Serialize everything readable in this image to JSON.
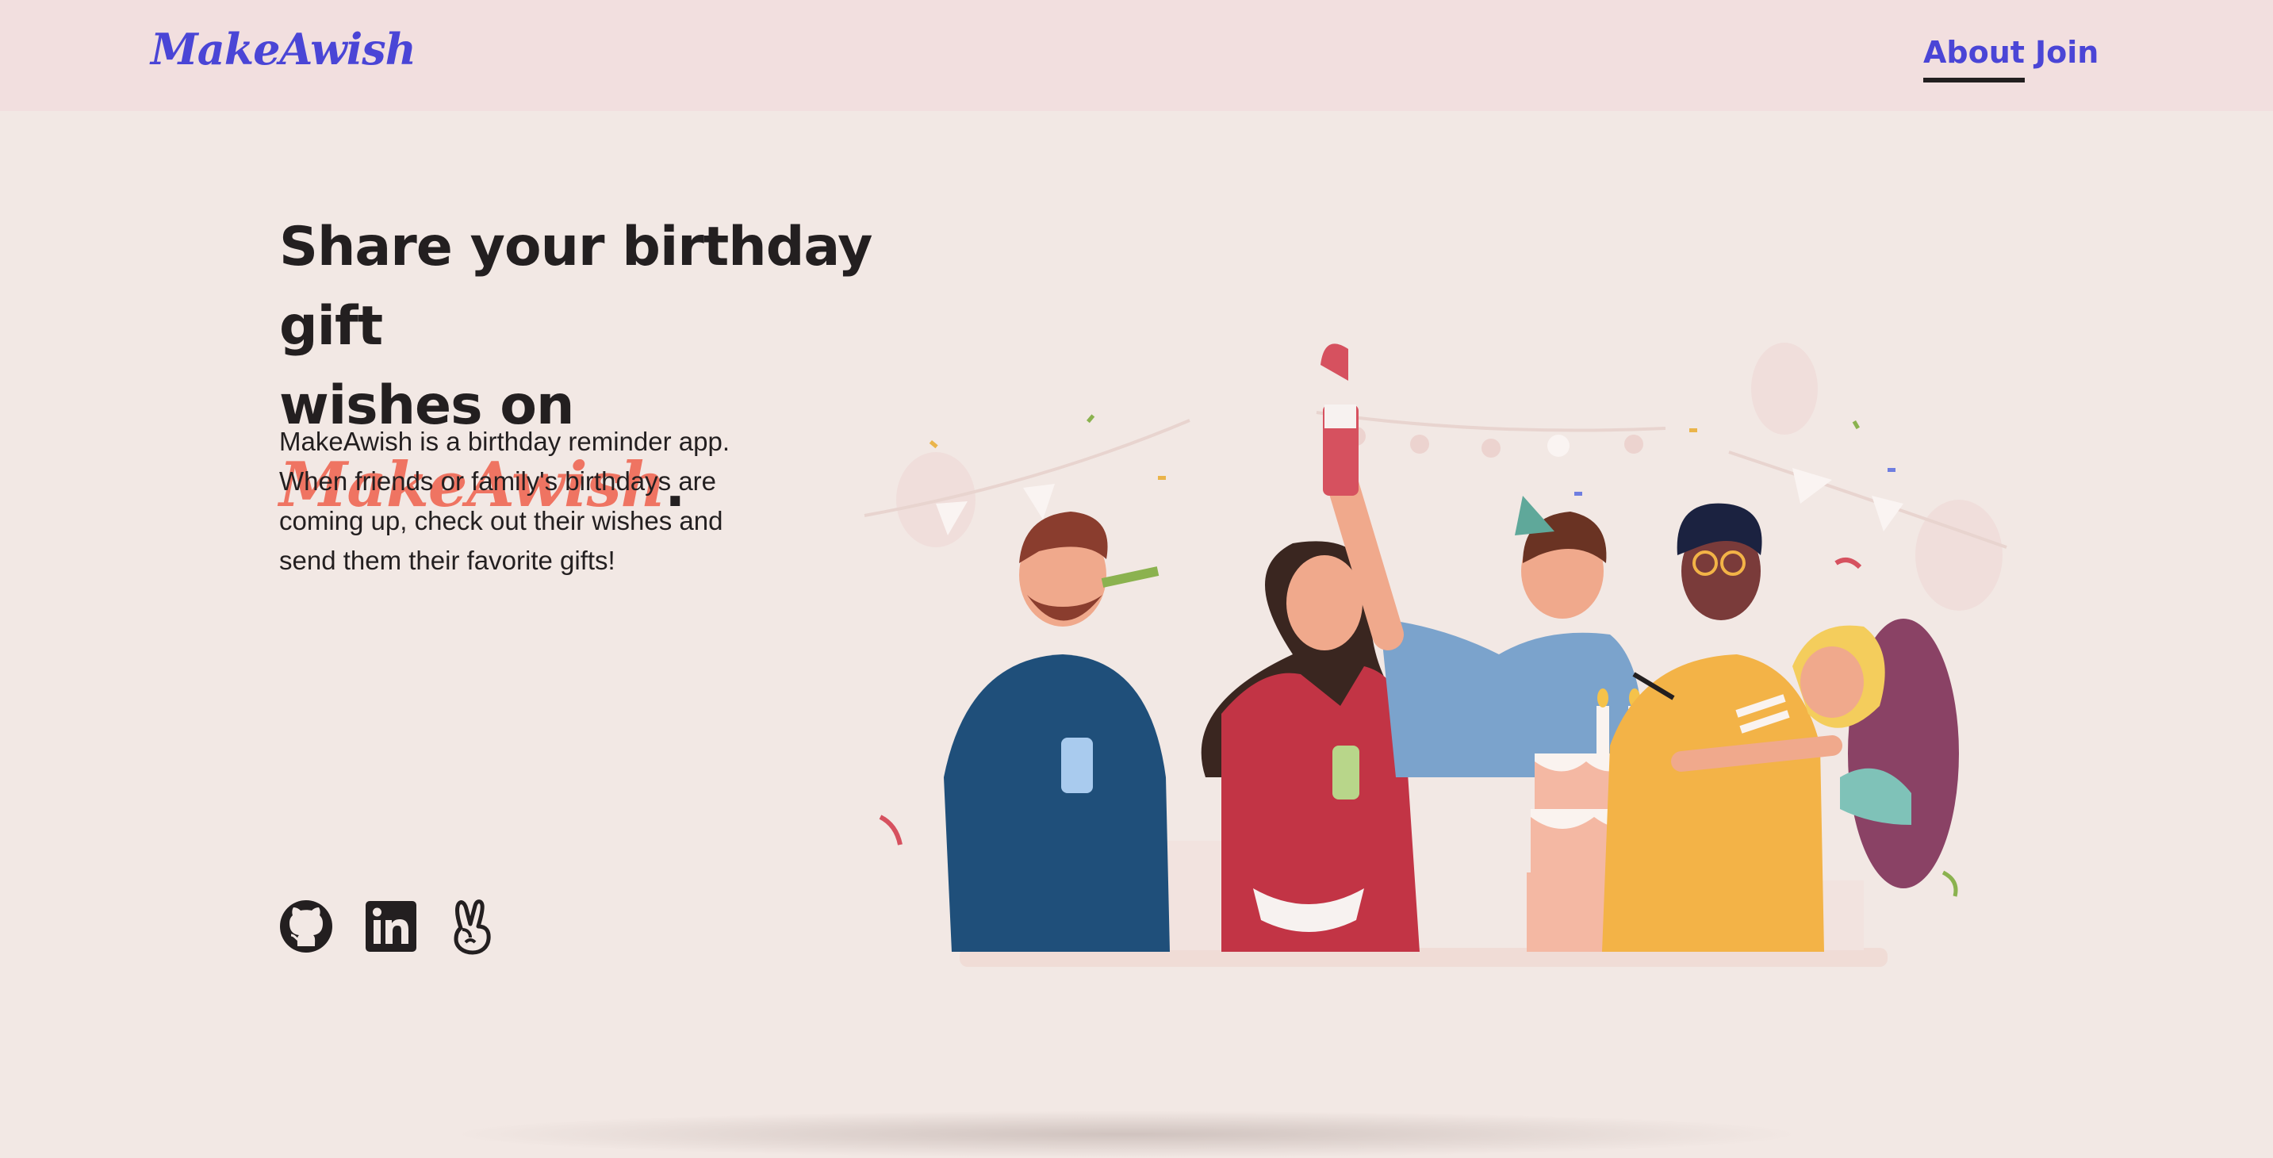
{
  "header": {
    "logo": "MakeAwish",
    "nav": [
      {
        "label": "About",
        "active": true
      },
      {
        "label": "Join",
        "active": false
      }
    ]
  },
  "hero": {
    "headline_line1": "Share your birthday gift",
    "headline_prefix": "wishes on ",
    "headline_brand": "MakeAwish",
    "headline_suffix": ".",
    "description": "MakeAwish is a birthday reminder app. When friends or family's birthdays are coming up, check out their wishes and send them their favorite gifts!"
  },
  "social": [
    {
      "name": "github-icon"
    },
    {
      "name": "linkedin-icon"
    },
    {
      "name": "angellist-icon"
    }
  ],
  "colors": {
    "accent": "#4a45d6",
    "brand_highlight": "#ef7462",
    "background": "#f2e8e4",
    "header_background": "#f2dfdf",
    "text": "#231f20"
  }
}
